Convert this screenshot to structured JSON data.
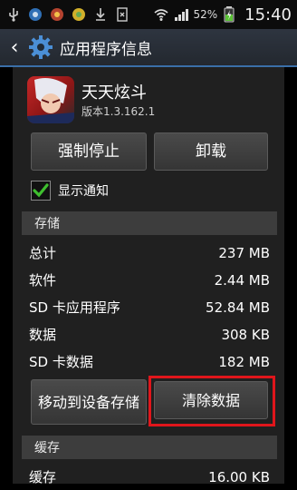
{
  "status_bar": {
    "icons_left": [
      "usb-icon",
      "app-notification-icon",
      "app-notification-icon",
      "app-notification-icon",
      "download-icon",
      "file-icon"
    ],
    "battery_percent": "52%",
    "time": "15:40"
  },
  "action_bar": {
    "title": "应用程序信息"
  },
  "app": {
    "name": "天天炫斗",
    "version": "版本1.3.162.1"
  },
  "buttons": {
    "force_stop": "强制停止",
    "uninstall": "卸载",
    "move_to_device": "移动到设备存储",
    "clear_data": "清除数据"
  },
  "notification": {
    "label": "显示通知",
    "checked": true
  },
  "storage": {
    "header": "存储",
    "rows": [
      {
        "label": "总计",
        "value": "237 MB"
      },
      {
        "label": "软件",
        "value": "2.44 MB"
      },
      {
        "label": "SD 卡应用程序",
        "value": "52.84 MB"
      },
      {
        "label": "数据",
        "value": "308 KB"
      },
      {
        "label": "SD 卡数据",
        "value": "182 MB"
      }
    ]
  },
  "cache": {
    "header": "缓存",
    "rows": [
      {
        "label": "缓存",
        "value": "16.00 KB"
      }
    ]
  },
  "colors": {
    "highlight": "#e0161b",
    "action_bar_accent": "#3a6fa8",
    "checkbox_check": "#3fbf2f"
  }
}
